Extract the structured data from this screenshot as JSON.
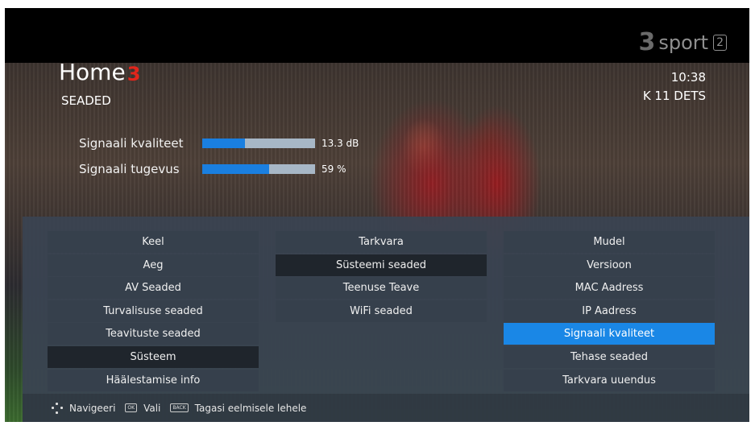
{
  "channel_logo": {
    "three": "3",
    "word": "sport",
    "number": "2"
  },
  "brand": {
    "home": "Home",
    "three": "3"
  },
  "page_title": "SEADED",
  "time": "10:38",
  "date": "K 11 DETS",
  "signal": [
    {
      "label": "Signaali kvaliteet",
      "level": 0.38,
      "value": "13.3 dB"
    },
    {
      "label": "Signaali tugevus",
      "level": 0.59,
      "value": "59 %"
    }
  ],
  "menu": {
    "col1": [
      "Keel",
      "Aeg",
      "AV Seaded",
      "Turvalisuse seaded",
      "Teavituste seaded",
      "Süsteem",
      "Häälestamise info"
    ],
    "col2": [
      "Tarkvara",
      "Süsteemi seaded",
      "Teenuse Teave",
      "WiFi seaded"
    ],
    "col3": [
      "Mudel",
      "Versioon",
      "MAC Aadress",
      "IP Aadress",
      "Signaali kvaliteet",
      "Tehase seaded",
      "Tarkvara uuendus"
    ]
  },
  "footer": {
    "navigate": "Navigeeri",
    "ok_key": "OK",
    "select": "Vali",
    "back_key": "BACK",
    "back": "Tagasi eelmisele lehele"
  },
  "colors": {
    "accent": "#1a87e6",
    "brand_red": "#e1251b"
  }
}
